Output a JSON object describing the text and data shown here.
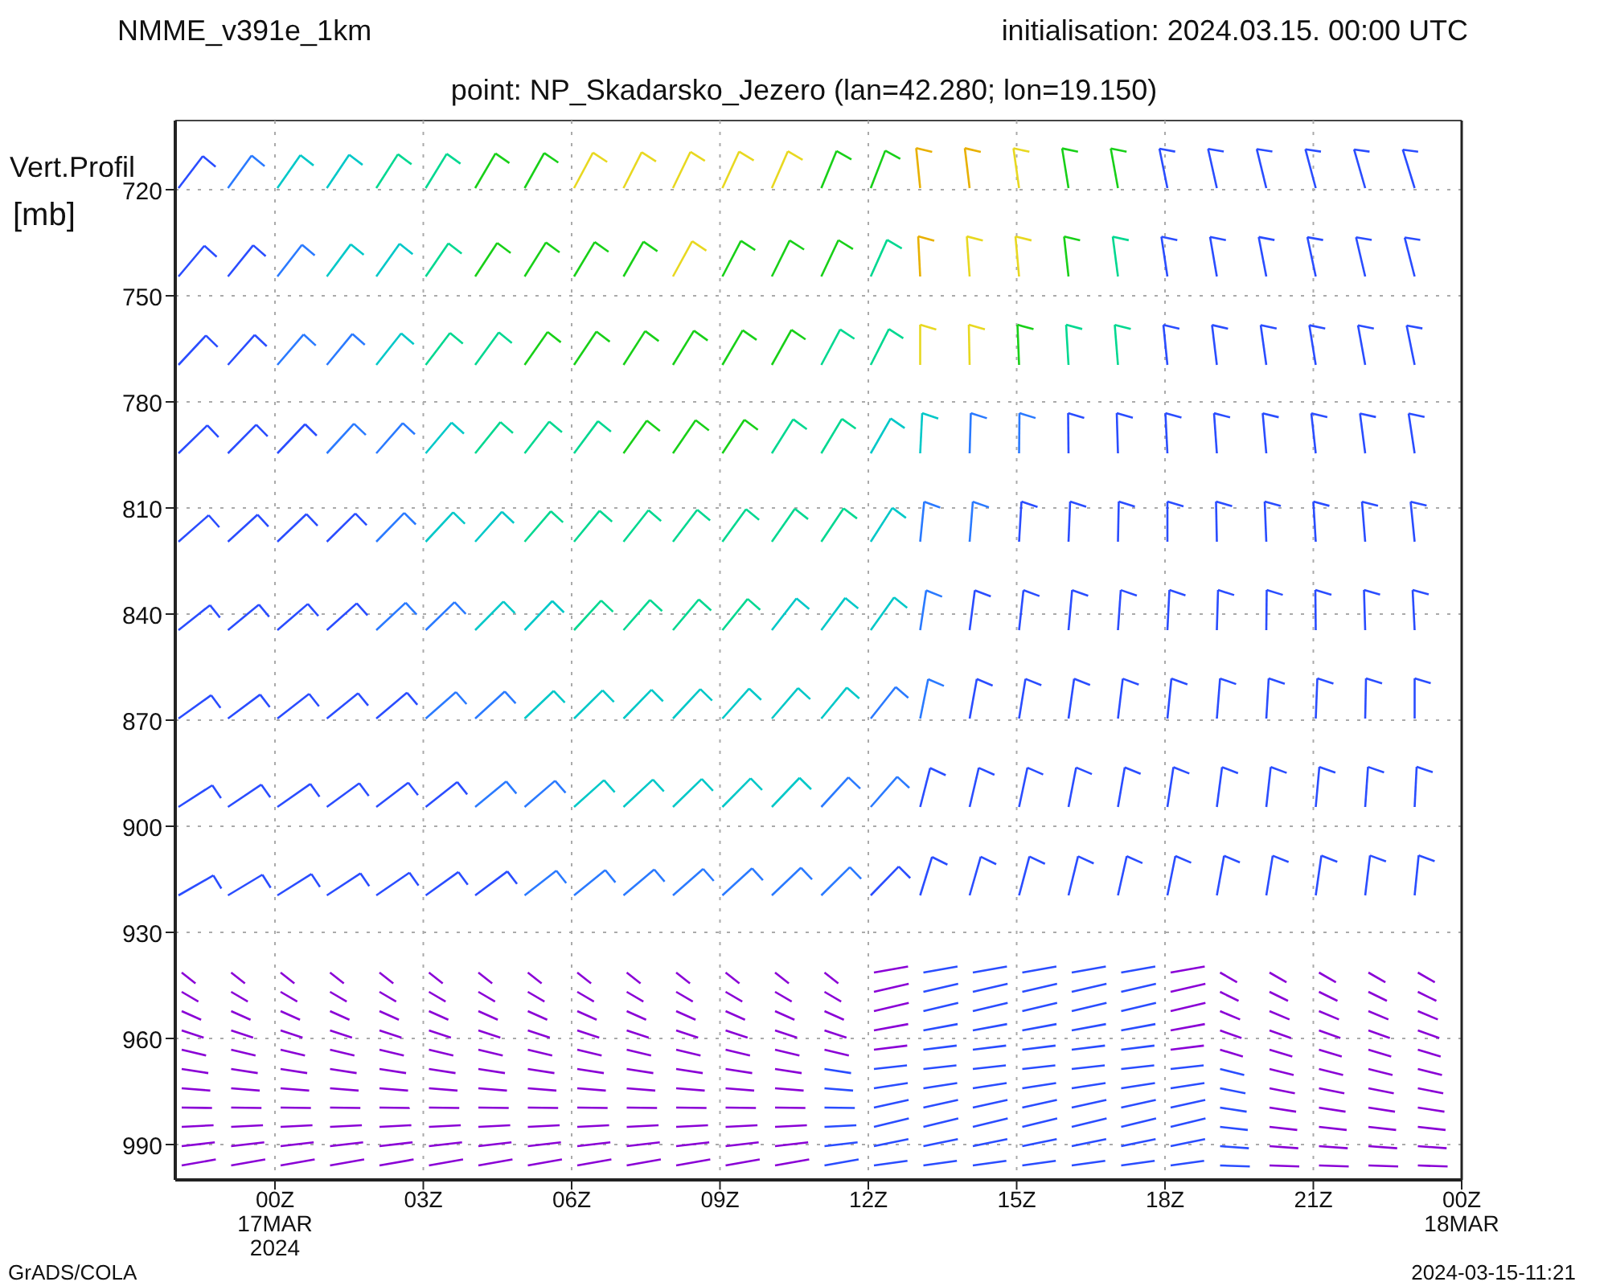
{
  "header": {
    "model": "NMME_v391e_1km",
    "initialisation": "initialisation: 2024.03.15. 00:00 UTC",
    "point": "point: NP_Skadarsko_Jezero (lan=42.280; lon=19.150)"
  },
  "plot": {
    "y_title": "Vert.Profil",
    "y_unit": "[mb]",
    "y_ticks": [
      "720",
      "750",
      "780",
      "810",
      "840",
      "870",
      "900",
      "930",
      "960",
      "990"
    ],
    "x_ticks": [
      {
        "label": "00Z",
        "sublabels": [
          "17MAR",
          "2024"
        ]
      },
      {
        "label": "03Z"
      },
      {
        "label": "06Z"
      },
      {
        "label": "09Z"
      },
      {
        "label": "12Z"
      },
      {
        "label": "15Z"
      },
      {
        "label": "18Z"
      },
      {
        "label": "21Z"
      },
      {
        "label": "00Z",
        "sublabels": [
          "18MAR"
        ]
      }
    ]
  },
  "footer": {
    "left": "GrADS/COLA",
    "right": "2024-03-15-11:21"
  }
}
